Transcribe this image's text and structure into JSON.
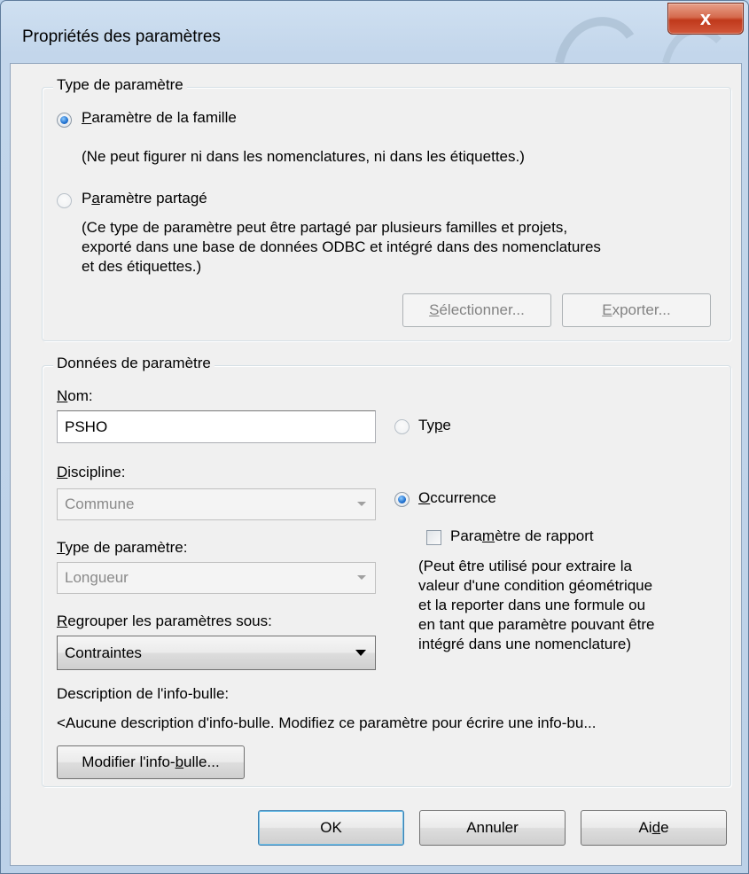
{
  "window": {
    "title": "Propriétés des paramètres",
    "close_label": "x"
  },
  "type_group": {
    "legend": "Type de paramètre",
    "family_radio": {
      "pre": "",
      "accel": "P",
      "post": "aramètre de la famille",
      "checked": true
    },
    "family_hint": "(Ne peut figurer ni dans les nomenclatures, ni dans les étiquettes.)",
    "shared_radio": {
      "pre": "P",
      "accel": "a",
      "post": "ramètre partagé",
      "checked": false
    },
    "shared_hint": [
      "(Ce type de paramètre peut être partagé par plusieurs familles et projets,",
      "exporté dans une base de données ODBC et intégré dans des nomenclatures",
      "et des étiquettes.)"
    ],
    "select_button": {
      "accel": "S",
      "post": "électionner..."
    },
    "export_button": {
      "accel": "E",
      "post": "xporter..."
    }
  },
  "data_group": {
    "legend": "Données de paramètre",
    "name_label": {
      "accel": "N",
      "post": "om:"
    },
    "name_value": "PSHO",
    "type_radio": {
      "pre": "Ty",
      "accel": "p",
      "post": "e",
      "checked": false
    },
    "discipline_label": {
      "accel": "D",
      "post": "iscipline:"
    },
    "discipline_value": "Commune",
    "occurrence_radio": {
      "pre": "",
      "accel": "O",
      "post": "ccurrence",
      "checked": true
    },
    "param_type_label": {
      "accel": "T",
      "post": "ype de paramètre:"
    },
    "param_type_value": "Longueur",
    "report_checkbox": {
      "pre": "Para",
      "accel": "m",
      "post": "ètre de rapport",
      "checked": false
    },
    "report_hint": [
      "(Peut être utilisé pour extraire la",
      "valeur d'une condition géométrique",
      "et la reporter dans une formule ou",
      "en tant que paramètre pouvant être",
      "intégré dans une nomenclature)"
    ],
    "group_label": {
      "accel": "R",
      "post": "egrouper les paramètres sous:"
    },
    "group_value": "Contraintes",
    "tooltip_label": "Description de l'info-bulle:",
    "tooltip_text": "<Aucune description d'info-bulle. Modifiez ce paramètre pour écrire une info-bu...",
    "edit_tooltip_button": {
      "pre": "Modifier l'info-",
      "accel": "b",
      "post": "ulle..."
    }
  },
  "footer": {
    "ok": "OK",
    "cancel": "Annuler",
    "help": {
      "pre": "Ai",
      "accel": "d",
      "post": "e"
    }
  },
  "colors": {
    "accent": "#1f6fce",
    "close": "#c0391b",
    "disabled_text": "#8a8a8a"
  }
}
